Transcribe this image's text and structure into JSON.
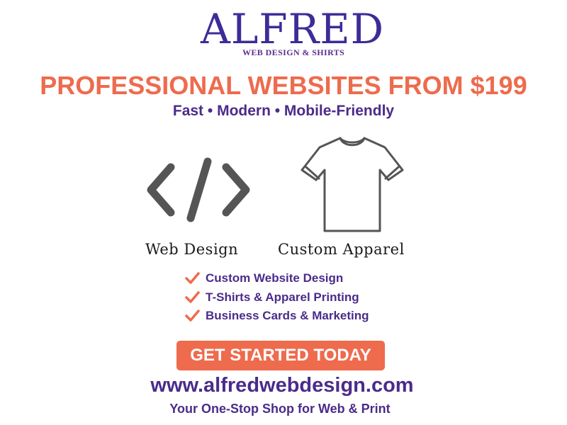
{
  "logo": {
    "name": "ALFRED",
    "subtitle": "WEB DESIGN & SHIRTS"
  },
  "headline": "PROFESSIONAL WEBSITES FROM $199",
  "tagline": "Fast • Modern • Mobile-Friendly",
  "services": [
    {
      "label": "Web Design",
      "icon": "code-icon"
    },
    {
      "label": "Custom Apparel",
      "icon": "t-shirt-icon"
    }
  ],
  "features": [
    "Custom Website Design",
    "T-Shirts & Apparel Printing",
    "Business Cards & Marketing"
  ],
  "cta_label": "GET STARTED TODAY",
  "website": "www.alfredwebdesign.com",
  "slogan": "Your One-Stop Shop for Web & Print",
  "colors": {
    "accent": "#ee6b4d",
    "brand_purple": "#4b2b8a",
    "logo_blue": "#3d2c97",
    "icon_gray": "#555555"
  }
}
